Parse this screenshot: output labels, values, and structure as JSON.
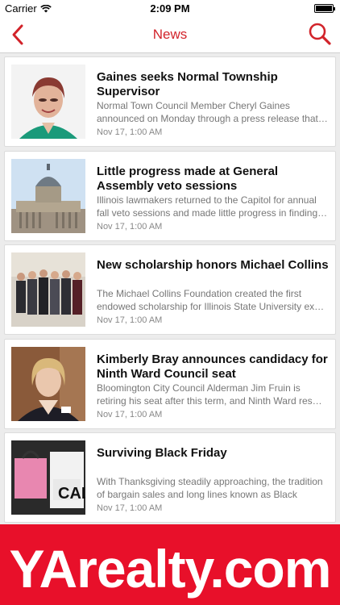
{
  "status": {
    "carrier": "Carrier",
    "time": "2:09 PM"
  },
  "nav": {
    "title": "News",
    "back_icon": "chevron-left-icon",
    "search_icon": "search-icon",
    "accent": "#d2232a"
  },
  "articles": [
    {
      "title": "Gaines seeks Normal Township Supervisor",
      "summary": "Normal Town Council Member Cheryl Gaines announced on Monday through a press release that…",
      "date": "Nov 17, 1:00 AM"
    },
    {
      "title": "Little progress made at General Assembly veto sessions",
      "summary": "Illinois lawmakers returned to the Capitol for annual fall veto sessions and made little progress in finding…",
      "date": "Nov 17, 1:00 AM"
    },
    {
      "title": "New scholarship honors Michael Collins",
      "summary": "The Michael Collins Foundation created the first endowed scholarship for Illinois State University ex…",
      "date": "Nov 17, 1:00 AM"
    },
    {
      "title": "Kimberly Bray announces candidacy for Ninth Ward Council seat",
      "summary": "Bloomington City Council Alderman Jim Fruin is retiring his seat after this term, and Ninth Ward res…",
      "date": "Nov 17, 1:00 AM"
    },
    {
      "title": "Surviving Black Friday",
      "summary": "With Thanksgiving steadily approaching, the tradition of bargain sales and long lines known as Black Frida…",
      "date": "Nov 17, 1:00 AM"
    }
  ],
  "banner": {
    "text": "YArealty.com",
    "color": "#e8102a"
  }
}
